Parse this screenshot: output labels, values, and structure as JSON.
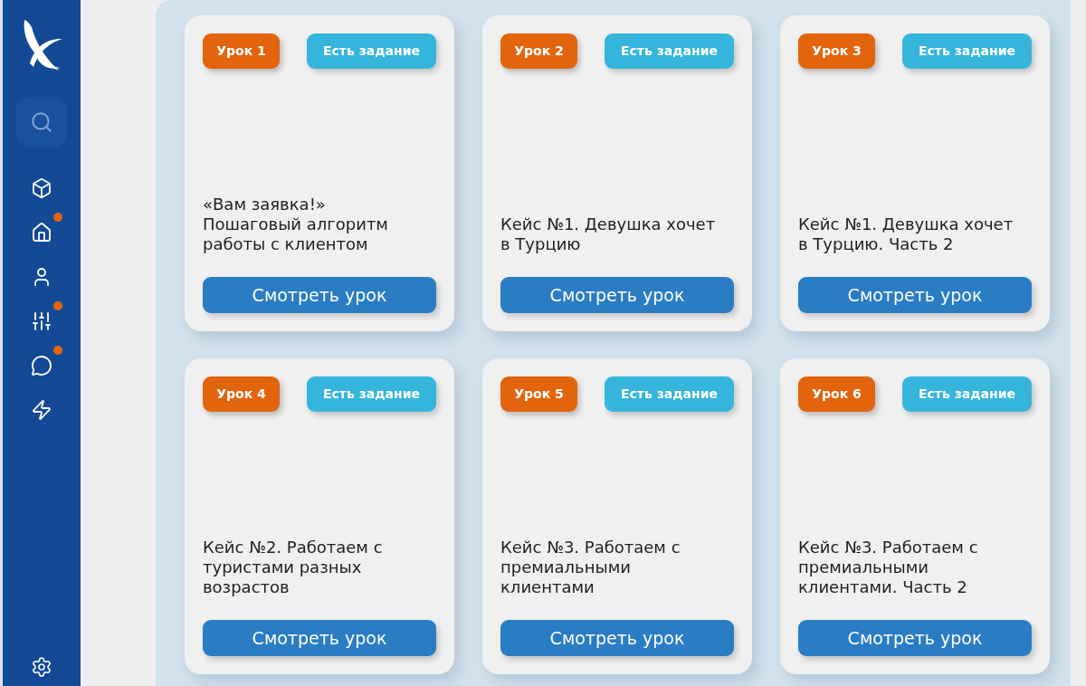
{
  "sidebar": {
    "nav_items": [
      {
        "notification": false
      },
      {
        "notification": true
      },
      {
        "notification": false
      },
      {
        "notification": true
      },
      {
        "notification": true
      },
      {
        "notification": false
      }
    ]
  },
  "lessons": [
    {
      "lesson": "Урок 1",
      "tag": "Есть задание",
      "title": "«Вам заявка!»\nПошаговый алгоритм\nработы с клиентом",
      "button": "Смотреть урок"
    },
    {
      "lesson": "Урок 2",
      "tag": "Есть задание",
      "title": "Кейс №1. Девушка хочет\nв Турцию",
      "button": "Смотреть урок"
    },
    {
      "lesson": "Урок 3",
      "tag": "Есть задание",
      "title": "Кейс №1. Девушка хочет\nв Турцию. Часть 2",
      "button": "Смотреть урок"
    },
    {
      "lesson": "Урок 4",
      "tag": "Есть задание",
      "title": "Кейс №2. Работаем с\nтуристами разных\nвозрастов",
      "button": "Смотреть урок"
    },
    {
      "lesson": "Урок 5",
      "tag": "Есть задание",
      "title": "Кейс №3. Работаем с\nпремиальными\nклиентами",
      "button": "Смотреть урок"
    },
    {
      "lesson": "Урок 6",
      "tag": "Есть задание",
      "title": "Кейс №3. Работаем с\nпремиальными\nклиентами. Часть 2",
      "button": "Смотреть урок"
    }
  ]
}
